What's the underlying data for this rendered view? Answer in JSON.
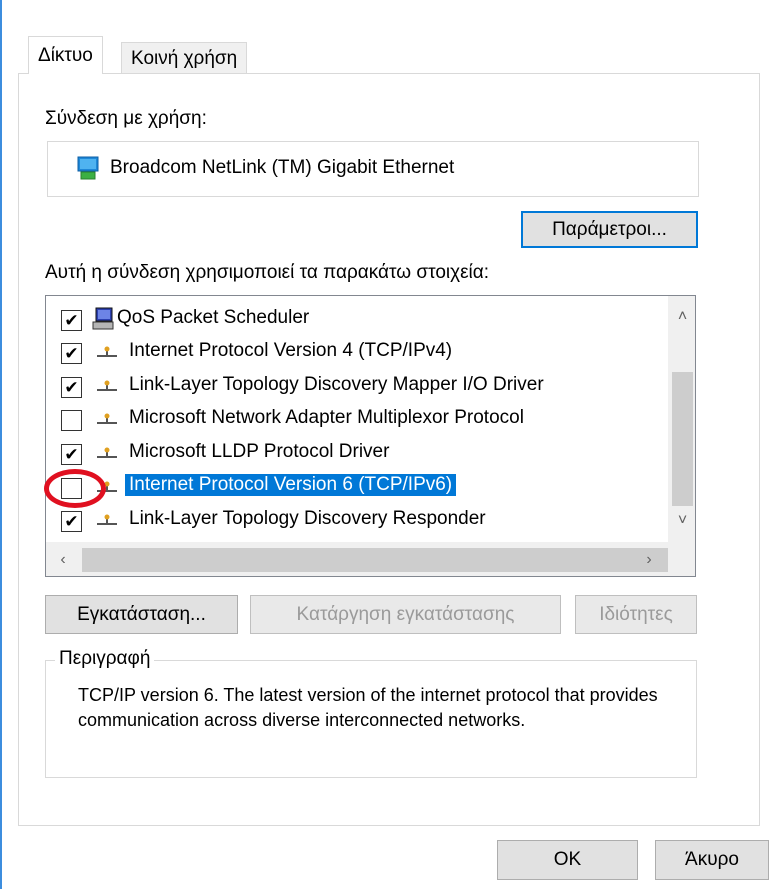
{
  "tabs": [
    {
      "label": "Δίκτυο",
      "active": true
    },
    {
      "label": "Κοινή χρήση",
      "active": false
    }
  ],
  "connect_using_label": "Σύνδεση με χρήση:",
  "adapter": {
    "name": "Broadcom NetLink (TM) Gigabit Ethernet",
    "icon": "network-adapter-icon"
  },
  "configure_button": "Παράμετροι...",
  "items_label": "Αυτή η σύνδεση χρησιμοποιεί τα παρακάτω στοιχεία:",
  "components": [
    {
      "label": "QoS Packet Scheduler",
      "checked": true,
      "icon": "scheduler-icon",
      "selected": false
    },
    {
      "label": "Internet Protocol Version 4 (TCP/IPv4)",
      "checked": true,
      "icon": "protocol-icon",
      "selected": false
    },
    {
      "label": "Link-Layer Topology Discovery Mapper I/O Driver",
      "checked": true,
      "icon": "protocol-icon",
      "selected": false
    },
    {
      "label": "Microsoft Network Adapter Multiplexor Protocol",
      "checked": false,
      "icon": "protocol-icon",
      "selected": false
    },
    {
      "label": "Microsoft LLDP Protocol Driver",
      "checked": true,
      "icon": "protocol-icon",
      "selected": false
    },
    {
      "label": "Internet Protocol Version 6 (TCP/IPv6)",
      "checked": false,
      "icon": "protocol-icon",
      "selected": true
    },
    {
      "label": "Link-Layer Topology Discovery Responder",
      "checked": true,
      "icon": "protocol-icon",
      "selected": false
    }
  ],
  "buttons": {
    "install": "Εγκατάσταση...",
    "uninstall": "Κατάργηση εγκατάστασης",
    "properties": "Ιδιότητες"
  },
  "description": {
    "title": "Περιγραφή",
    "text": "TCP/IP version 6. The latest version of the internet protocol that provides communication across diverse interconnected networks."
  },
  "dialog_buttons": {
    "ok": "OK",
    "cancel": "Άκυρο"
  },
  "colors": {
    "accent": "#0078d7",
    "annotation": "#e01020"
  }
}
